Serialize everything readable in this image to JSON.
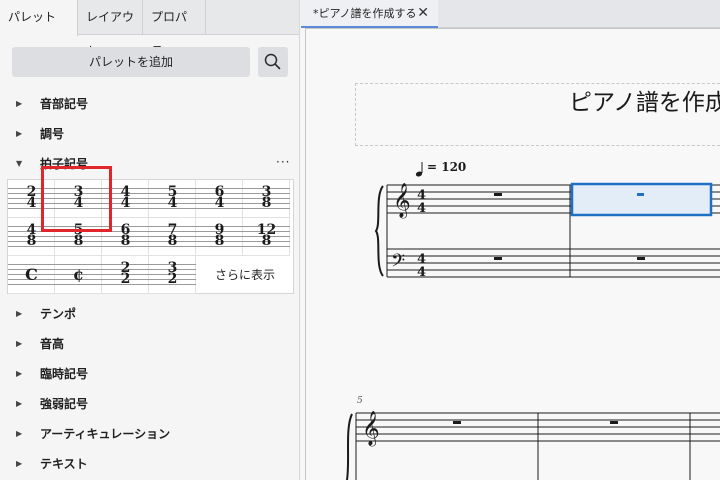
{
  "tabs": [
    {
      "label": "パレット",
      "more": "···",
      "active": true
    },
    {
      "label": "レイアウト",
      "active": false
    },
    {
      "label": "プロパティ",
      "active": false
    }
  ],
  "add_palette_label": "パレットを追加",
  "sections_top": [
    {
      "label": "音部記号",
      "expanded": false
    },
    {
      "label": "調号",
      "expanded": false
    },
    {
      "label": "拍子記号",
      "expanded": true,
      "more": "···"
    }
  ],
  "time_signatures": [
    {
      "num": "2",
      "den": "4"
    },
    {
      "num": "3",
      "den": "4"
    },
    {
      "num": "4",
      "den": "4"
    },
    {
      "num": "5",
      "den": "4"
    },
    {
      "num": "6",
      "den": "4"
    },
    {
      "num": "3",
      "den": "8"
    },
    {
      "num": "4",
      "den": "8"
    },
    {
      "num": "5",
      "den": "8"
    },
    {
      "num": "6",
      "den": "8"
    },
    {
      "num": "7",
      "den": "8"
    },
    {
      "num": "9",
      "den": "8"
    },
    {
      "num": "12",
      "den": "8"
    },
    {
      "symbol": "C"
    },
    {
      "symbol": "¢"
    },
    {
      "num": "2",
      "den": "2"
    },
    {
      "num": "3",
      "den": "2"
    }
  ],
  "show_more_label": "さらに表示",
  "sections_bottom": [
    {
      "label": "テンポ"
    },
    {
      "label": "音高"
    },
    {
      "label": "臨時記号"
    },
    {
      "label": "強弱記号"
    },
    {
      "label": "アーティキュレーション"
    },
    {
      "label": "テキスト"
    }
  ],
  "document_tab": {
    "title": "*ピアノ譜を作成する",
    "close": "✕"
  },
  "score": {
    "title": "ピアノ譜を作成",
    "tempo_text": "= 120",
    "time_signature": {
      "num": "4",
      "den": "4"
    },
    "measure_number": "5"
  },
  "colors": {
    "accent": "#1f6fc5",
    "highlight": "#e0262b",
    "selection_fill": "#e3edf8"
  }
}
